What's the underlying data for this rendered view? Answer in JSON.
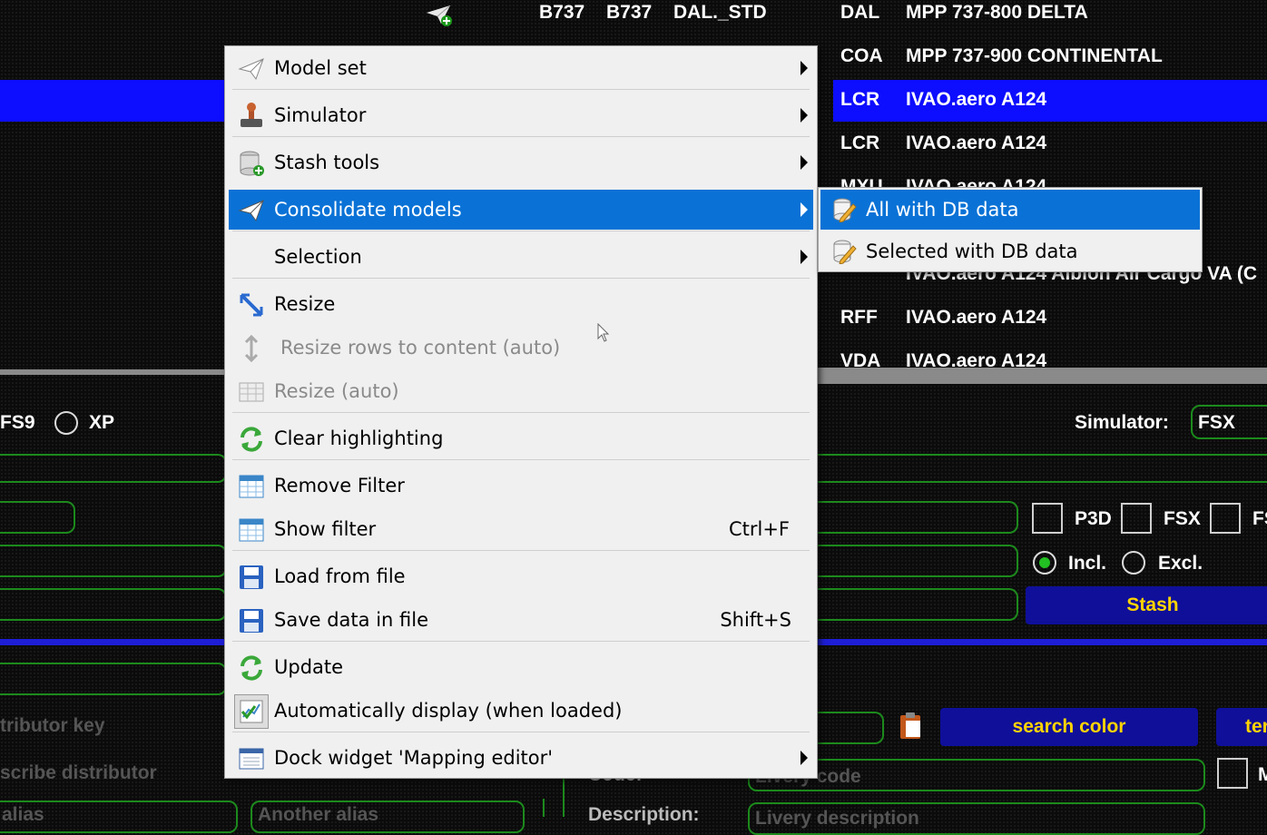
{
  "table": {
    "top_row": {
      "c1": "B737",
      "c2": "B737",
      "c3": "DAL._STD",
      "c4": "DAL",
      "c5": "MPP 737-800 DELTA"
    },
    "rows": [
      {
        "code": "COA",
        "model": "MPP 737-900 CONTINENTAL"
      },
      {
        "code": "LCR",
        "model": "IVAO.aero A124"
      },
      {
        "code": "LCR",
        "model": "IVAO.aero A124"
      },
      {
        "code": "MXU",
        "model": "IVAO.aero A124"
      },
      {
        "code": "",
        "model": "IVAO.aero A124 Albion Air Cargo VA (C"
      },
      {
        "code": "RFF",
        "model": "IVAO.aero A124"
      },
      {
        "code": "VDA",
        "model": "IVAO.aero A124"
      }
    ]
  },
  "left_panel": {
    "fs9": "FS9",
    "xp": "XP",
    "distributor_key": "tributor key",
    "describe_distributor": "scribe distributor",
    "alias": "alias",
    "another_alias": "Another alias"
  },
  "right_panel": {
    "simulator_label": "Simulator:",
    "simulator_value": "FSX",
    "p3d": "P3D",
    "fsx": "FSX",
    "fs_trunc": "FS",
    "incl": "Incl.",
    "excl": "Excl.",
    "stash": "Stash",
    "search_color": "search color",
    "ter": "ter",
    "code_label": "Code:",
    "livery_code": "Livery code",
    "m_trunc": "M",
    "description_label": "Description:",
    "livery_description": "Livery description"
  },
  "menu": {
    "items": [
      {
        "label": "Model set",
        "icon": "paper-plane-icon",
        "arrow": true
      },
      {
        "label": "Simulator",
        "icon": "joystick-icon",
        "arrow": true
      },
      {
        "label": "Stash tools",
        "icon": "database-add-icon",
        "arrow": true
      },
      {
        "label": "Consolidate models",
        "icon": "paper-plane-icon",
        "arrow": true,
        "highlighted": true
      },
      {
        "label": "Selection",
        "icon": "",
        "arrow": true
      },
      {
        "label": "Resize",
        "icon": "resize-diagonal-icon"
      },
      {
        "label": "Resize rows to content (auto)",
        "icon": "resize-vertical-icon",
        "disabled": true
      },
      {
        "label": "Resize (auto)",
        "icon": "table-icon",
        "disabled": true
      },
      {
        "label": "Clear highlighting",
        "icon": "refresh-icon"
      },
      {
        "label": "Remove Filter",
        "icon": "filter-table-icon"
      },
      {
        "label": "Show filter",
        "icon": "filter-table-icon",
        "shortcut": "Ctrl+F"
      },
      {
        "label": "Load from file",
        "icon": "floppy-icon"
      },
      {
        "label": "Save data in file",
        "icon": "floppy-icon",
        "shortcut": "Shift+S"
      },
      {
        "label": "Update",
        "icon": "refresh-icon"
      },
      {
        "label": "Automatically display (when loaded)",
        "icon": "chart-check-icon"
      },
      {
        "label": "Dock widget 'Mapping editor'",
        "icon": "window-icon",
        "arrow": true
      }
    ]
  },
  "submenu": {
    "items": [
      {
        "label": "All with DB data",
        "icon": "database-edit-icon",
        "highlighted": true
      },
      {
        "label": "Selected with DB data",
        "icon": "database-edit-icon"
      }
    ]
  },
  "colors": {
    "selection": "#0d0dff",
    "menu_highlight": "#0a72d6",
    "button_blue": "#0f0f9a",
    "button_text": "#ffd400",
    "border_green": "#1c8a1c"
  }
}
